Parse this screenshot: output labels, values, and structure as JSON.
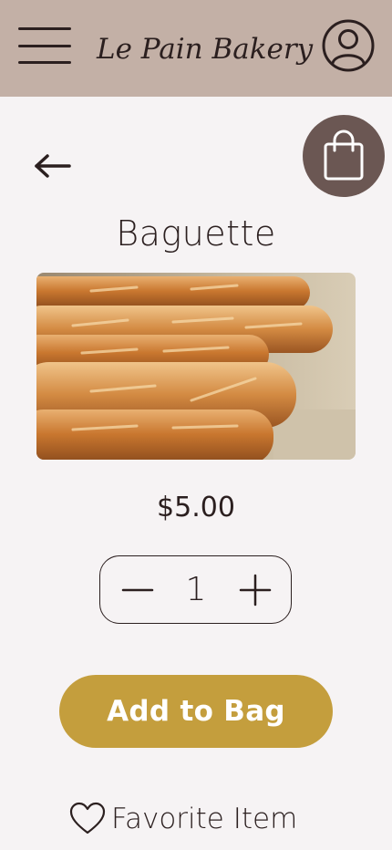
{
  "header": {
    "brand": "Le Pain Bakery",
    "background_color": "#c3b0a6",
    "menu_icon": "hamburger-menu-icon",
    "account_icon": "user-account-icon"
  },
  "nav": {
    "back_icon": "arrow-left-icon",
    "bag_icon": "shopping-bag-icon",
    "bag_color": "#6b5753"
  },
  "product": {
    "name": "Baguette",
    "price": "$5.00",
    "image": "baguette-photo"
  },
  "quantity": {
    "value": "1",
    "decrement_icon": "minus-icon",
    "increment_icon": "plus-icon"
  },
  "actions": {
    "add_to_bag_label": "Add to Bag",
    "add_to_bag_color": "#c49e3d",
    "favorite_label": "Favorite Item",
    "favorite_icon": "heart-icon"
  }
}
